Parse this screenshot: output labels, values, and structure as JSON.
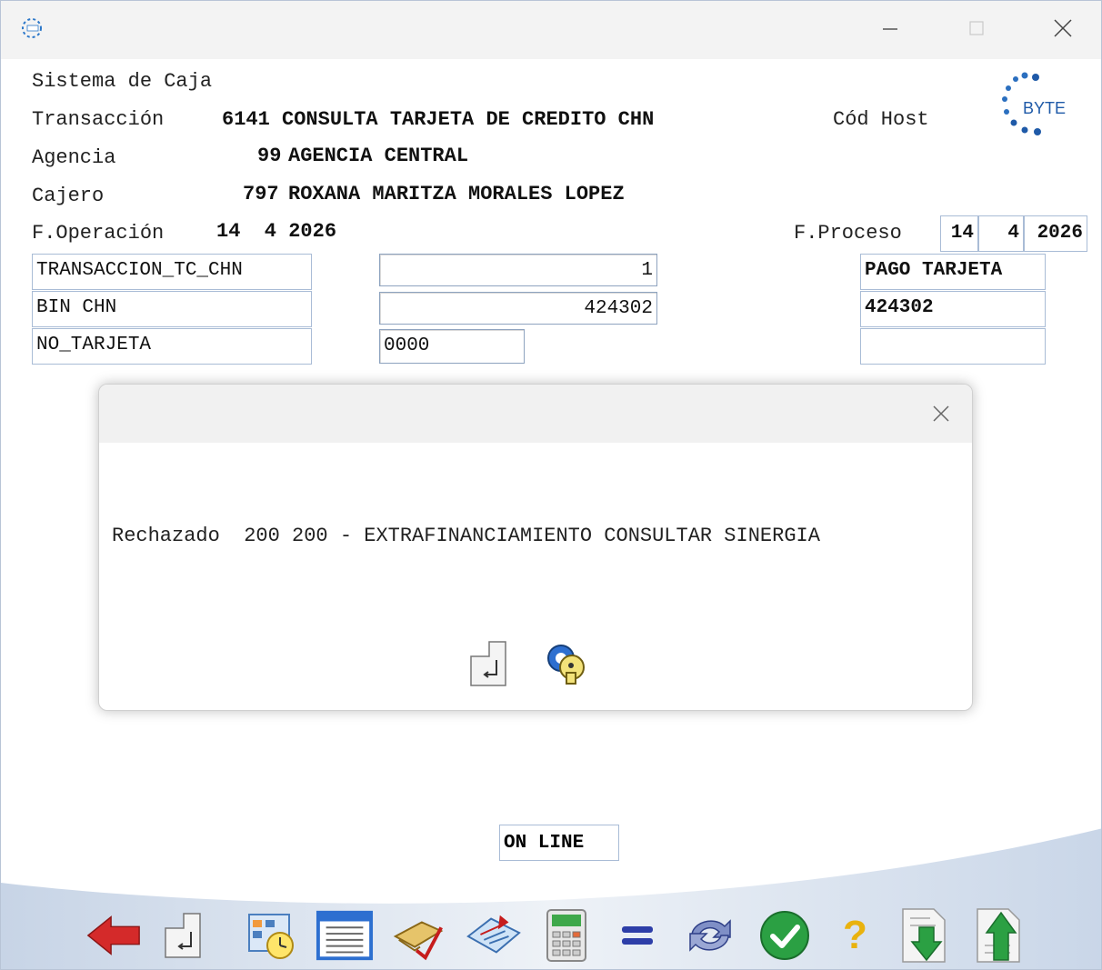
{
  "window": {
    "title_icon": "byte-app-icon",
    "minimize_icon": "minimize-icon",
    "maximize_icon": "maximize-icon",
    "close_icon": "close-icon"
  },
  "header": {
    "system_label": "Sistema de Caja",
    "transaction_label": "Transacción",
    "transaction_value": "6141 CONSULTA TARJETA DE CREDITO CHN",
    "host_code_label": "Cód Host",
    "agency_label": "Agencia",
    "agency_code": "99",
    "agency_name": "AGENCIA CENTRAL",
    "cashier_label": "Cajero",
    "cashier_code": "797",
    "cashier_name": "ROXANA MARITZA MORALES LOPEZ",
    "op_date_label": "F.Operación",
    "op_date_value": "14  4 2026",
    "process_date_label": "F.Proceso",
    "process_day": "14",
    "process_month": "4",
    "process_year": "2026",
    "logo_text": "BYTE"
  },
  "form": {
    "rows": [
      {
        "name": "TRANSACCION_TC_CHN",
        "value": "1",
        "description": "PAGO TARJETA"
      },
      {
        "name": "BIN CHN",
        "value": "424302",
        "description": "424302"
      },
      {
        "name": "NO_TARJETA",
        "value": "0000",
        "description": ""
      }
    ]
  },
  "dialog": {
    "message": "Rechazado  200 200 - EXTRAFINANCIAMIENTO CONSULTAR SINERGIA",
    "enter_icon": "enter-icon",
    "keys_icon": "keys-icon",
    "close_icon": "close-icon"
  },
  "status": {
    "online": "ON LINE"
  },
  "toolbar": {
    "items": [
      "back-arrow-icon",
      "enter-icon",
      "calendar-clock-icon",
      "list-document-icon",
      "pen-paper-icon",
      "stamp-icon",
      "calculator-icon",
      "equals-icon",
      "refresh-icon",
      "check-icon",
      "help-icon",
      "download-icon",
      "upload-icon"
    ]
  },
  "colors": {
    "accent_red": "#d42a2a",
    "accent_green": "#2ba043",
    "accent_blue": "#1a5fc2",
    "help_yellow": "#e9b20e"
  }
}
